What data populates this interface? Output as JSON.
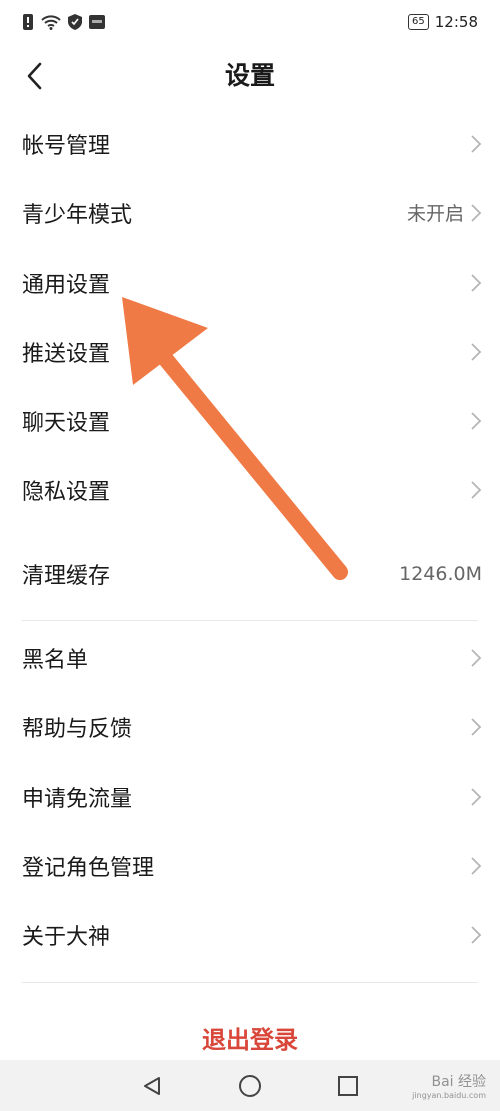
{
  "status_bar": {
    "battery": "65",
    "time": "12:58",
    "icons": [
      "alert-icon",
      "wifi-icon",
      "shield-icon",
      "app-badge-icon",
      "battery-icon"
    ]
  },
  "header": {
    "title": "设置",
    "back_icon": "chevron-left-icon"
  },
  "settings": {
    "items": [
      {
        "label": "帐号管理",
        "value": "",
        "chevron": true
      },
      {
        "label": "青少年模式",
        "value": "未开启",
        "chevron": true
      },
      {
        "label": "通用设置",
        "value": "",
        "chevron": true
      },
      {
        "label": "推送设置",
        "value": "",
        "chevron": true
      },
      {
        "label": "聊天设置",
        "value": "",
        "chevron": true
      },
      {
        "label": "隐私设置",
        "value": "",
        "chevron": true
      },
      {
        "label": "清理缓存",
        "value": "1246.0M",
        "chevron": false
      },
      {
        "label": "黑名单",
        "value": "",
        "chevron": true
      },
      {
        "label": "帮助与反馈",
        "value": "",
        "chevron": true
      },
      {
        "label": "申请免流量",
        "value": "",
        "chevron": true
      },
      {
        "label": "登记角色管理",
        "value": "",
        "chevron": true
      },
      {
        "label": "关于大神",
        "value": "",
        "chevron": true
      }
    ]
  },
  "logout_label": "退出登录",
  "system_nav": {
    "icons": [
      "back-triangle-icon",
      "home-circle-icon",
      "recents-square-icon"
    ]
  },
  "annotation": {
    "arrow_color": "#f07a45"
  },
  "watermark": {
    "text": "Bai 经验",
    "subtext": "jingyan.baidu.com"
  }
}
